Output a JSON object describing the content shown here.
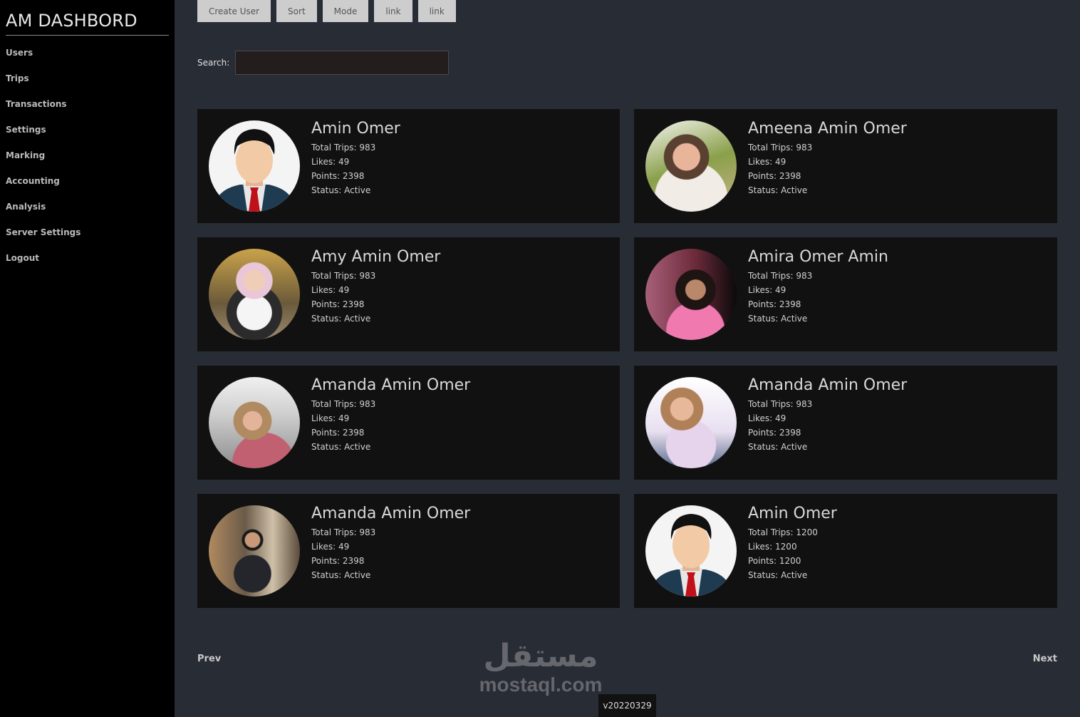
{
  "brand": "AM DASHBORD",
  "nav": [
    "Users",
    "Trips",
    "Transactions",
    "Settings",
    "Marking",
    "Accounting",
    "Analysis",
    "Server Settings",
    "Logout"
  ],
  "toolbar": [
    "Create User",
    "Sort",
    "Mode",
    "link",
    "link"
  ],
  "search": {
    "label": "Search:",
    "value": "",
    "placeholder": ""
  },
  "users": [
    {
      "name": "Amin Omer",
      "trips": "Total Trips: 983",
      "likes": "Likes: 49",
      "points": "Points: 2398",
      "status": "Status: Active",
      "avatar": "illustrated-man"
    },
    {
      "name": "Ameena Amin Omer",
      "trips": "Total Trips: 983",
      "likes": "Likes: 49",
      "points": "Points: 2398",
      "status": "Status: Active",
      "avatar": "photo"
    },
    {
      "name": "Amy Amin Omer",
      "trips": "Total Trips: 983",
      "likes": "Likes: 49",
      "points": "Points: 2398",
      "status": "Status: Active",
      "avatar": "photo"
    },
    {
      "name": "Amira Omer Amin",
      "trips": "Total Trips: 983",
      "likes": "Likes: 49",
      "points": "Points: 2398",
      "status": "Status: Active",
      "avatar": "photo"
    },
    {
      "name": "Amanda Amin Omer",
      "trips": "Total Trips: 983",
      "likes": "Likes: 49",
      "points": "Points: 2398",
      "status": "Status: Active",
      "avatar": "photo"
    },
    {
      "name": "Amanda Amin Omer",
      "trips": "Total Trips: 983",
      "likes": "Likes: 49",
      "points": "Points: 2398",
      "status": "Status: Active",
      "avatar": "photo"
    },
    {
      "name": "Amanda Amin Omer",
      "trips": "Total Trips: 983",
      "likes": "Likes: 49",
      "points": "Points: 2398",
      "status": "Status: Active",
      "avatar": "photo"
    },
    {
      "name": "Amin Omer",
      "trips": "Total Trips: 1200",
      "likes": "Likes: 1200",
      "points": "Points: 1200",
      "status": "Status: Active",
      "avatar": "illustrated-man"
    }
  ],
  "pagination": {
    "prev": "Prev",
    "next": "Next"
  },
  "watermark": {
    "arabic": "مستقل",
    "latin": "mostaql.com"
  },
  "version": "v20220329"
}
